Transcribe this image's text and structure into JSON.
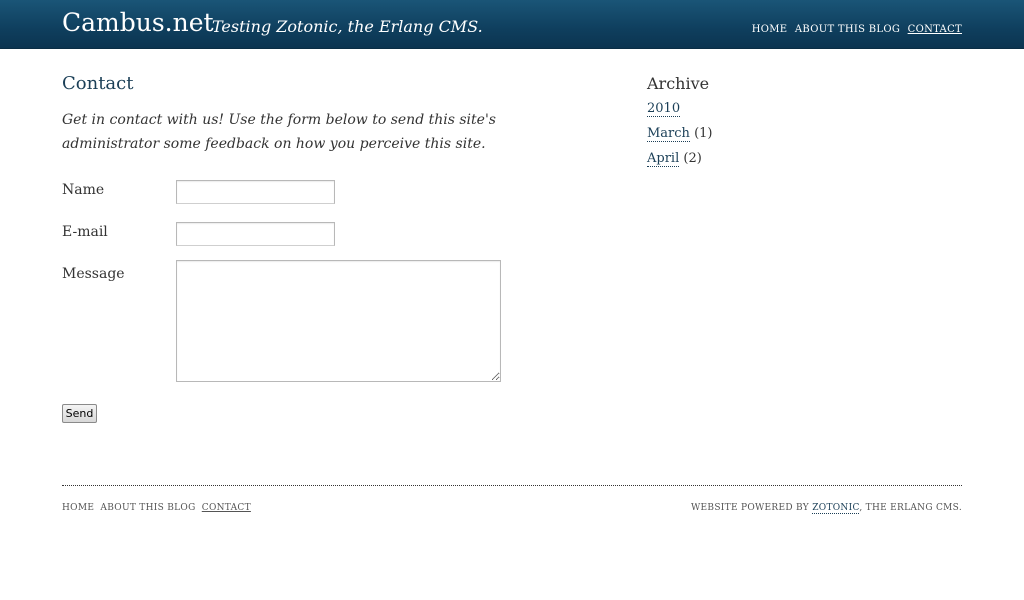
{
  "header": {
    "site_title": "Cambus.net",
    "tagline": "Testing Zotonic, the Erlang CMS.",
    "nav": [
      {
        "label": "HOME"
      },
      {
        "label": "ABOUT THIS BLOG"
      },
      {
        "label": "CONTACT",
        "active": true
      }
    ]
  },
  "main": {
    "title": "Contact",
    "intro": "Get in contact with us! Use the form below to send this site's administrator some feedback on how you perceive this site.",
    "form": {
      "name_label": "Name",
      "name_value": "",
      "email_label": "E-mail",
      "email_value": "",
      "message_label": "Message",
      "message_value": "",
      "send_label": "Send"
    }
  },
  "sidebar": {
    "title": "Archive",
    "year": "2010",
    "months": [
      {
        "label": "March",
        "count": "(1)"
      },
      {
        "label": "April",
        "count": "(2)"
      }
    ]
  },
  "footer": {
    "nav": [
      {
        "label": "HOME"
      },
      {
        "label": "ABOUT THIS BLOG"
      },
      {
        "label": "CONTACT",
        "active": true
      }
    ],
    "credit_prefix": "WEBSITE POWERED BY",
    "credit_link": "ZOTONIC",
    "credit_suffix": ", THE ERLANG CMS."
  },
  "colors": {
    "header_bg": "#0f3f5e",
    "title_blue": "#1b3f57",
    "text": "#333333"
  }
}
